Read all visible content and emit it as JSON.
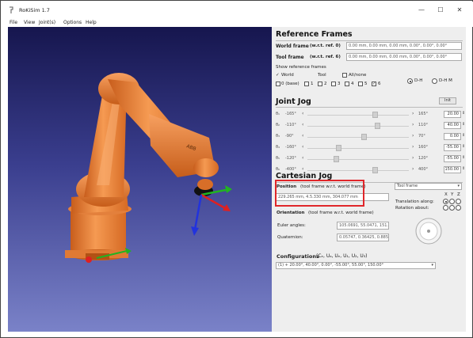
{
  "window": {
    "title": "RoKiSim 1.7",
    "minimize_glyph": "—",
    "maximize_glyph": "☐",
    "close_glyph": "✕"
  },
  "menu": [
    "File",
    "View",
    "Joint(s)",
    "Options",
    "Help"
  ],
  "reference_frames": {
    "title": "Reference Frames",
    "world_label": "World frame",
    "world_rel": "(w.r.t. ref. 0)",
    "world_value": "0.00 mm, 0.00 mm, 0.00 mm, 0.00°, 0.00°, 0.00°",
    "tool_label": "Tool frame",
    "tool_rel": "(w.r.t. ref. 6)",
    "tool_value": "0.00 mm, 0.00 mm, 0.00 mm, 0.00°, 0.00°, 0.00°",
    "show_label": "Show reference frames",
    "checks": [
      "World",
      "Tool",
      "All/none",
      "0 (base)",
      "1",
      "2",
      "3",
      "4",
      "5",
      "6"
    ],
    "dh_label": "D-H",
    "mdh_label": "D-H M"
  },
  "joint_jog": {
    "title": "Joint Jog",
    "init_button": "Init",
    "joints": [
      {
        "label": "θ₁",
        "min": "-165°",
        "max": "165°",
        "value": "20.00",
        "pos": 0.68
      },
      {
        "label": "θ₂",
        "min": "-110°",
        "max": "110°",
        "value": "40.00",
        "pos": 0.7
      },
      {
        "label": "θ₃",
        "min": "-90°",
        "max": "70°",
        "value": "0.00",
        "pos": 0.56
      },
      {
        "label": "θ₄",
        "min": "-160°",
        "max": "160°",
        "value": "-55.00",
        "pos": 0.3
      },
      {
        "label": "θ₅",
        "min": "-120°",
        "max": "120°",
        "value": "-55.00",
        "pos": 0.27
      },
      {
        "label": "θ₆",
        "min": "-400°",
        "max": "400°",
        "value": "150.00",
        "pos": 0.68
      }
    ]
  },
  "cartesian_jog": {
    "title": "Cartesian Jog",
    "position_label": "Position",
    "position_rel": "(tool frame w.r.t. world frame)",
    "position_value": "229.265 mm, 4.5.330 mm, 304.077 mm",
    "orientation_label": "Orientation",
    "orientation_rel": "(tool frame w.r.t. world frame)",
    "euler_label": "Euler angles:",
    "euler_value": "105.0691, 55.0471, 151.0517",
    "quaternion_label": "Quaternion:",
    "quaternion_value": "0.05747, 0.36425, 0.88503, 0.30603",
    "frame_select": "Tool frame",
    "translation_label": "Translation along:",
    "rotation_label": "Rotation about:",
    "axes": [
      "X",
      "Y",
      "Z"
    ]
  },
  "configurations": {
    "title": "Configurations",
    "symbols": "(Cₑ, Uₐ, Uₑ, U₁, U₂, U₃)",
    "selected": "(1)  + 20.00°, 40.00°, 0.00°, -55.00°, 55.00°, 150.00°"
  },
  "colors": {
    "robot": "#f07a2c",
    "robot_dark": "#c25a18",
    "axis_x": "#e02020",
    "axis_y": "#22b322",
    "axis_z": "#2233dd",
    "highlight": "#e0262a"
  }
}
